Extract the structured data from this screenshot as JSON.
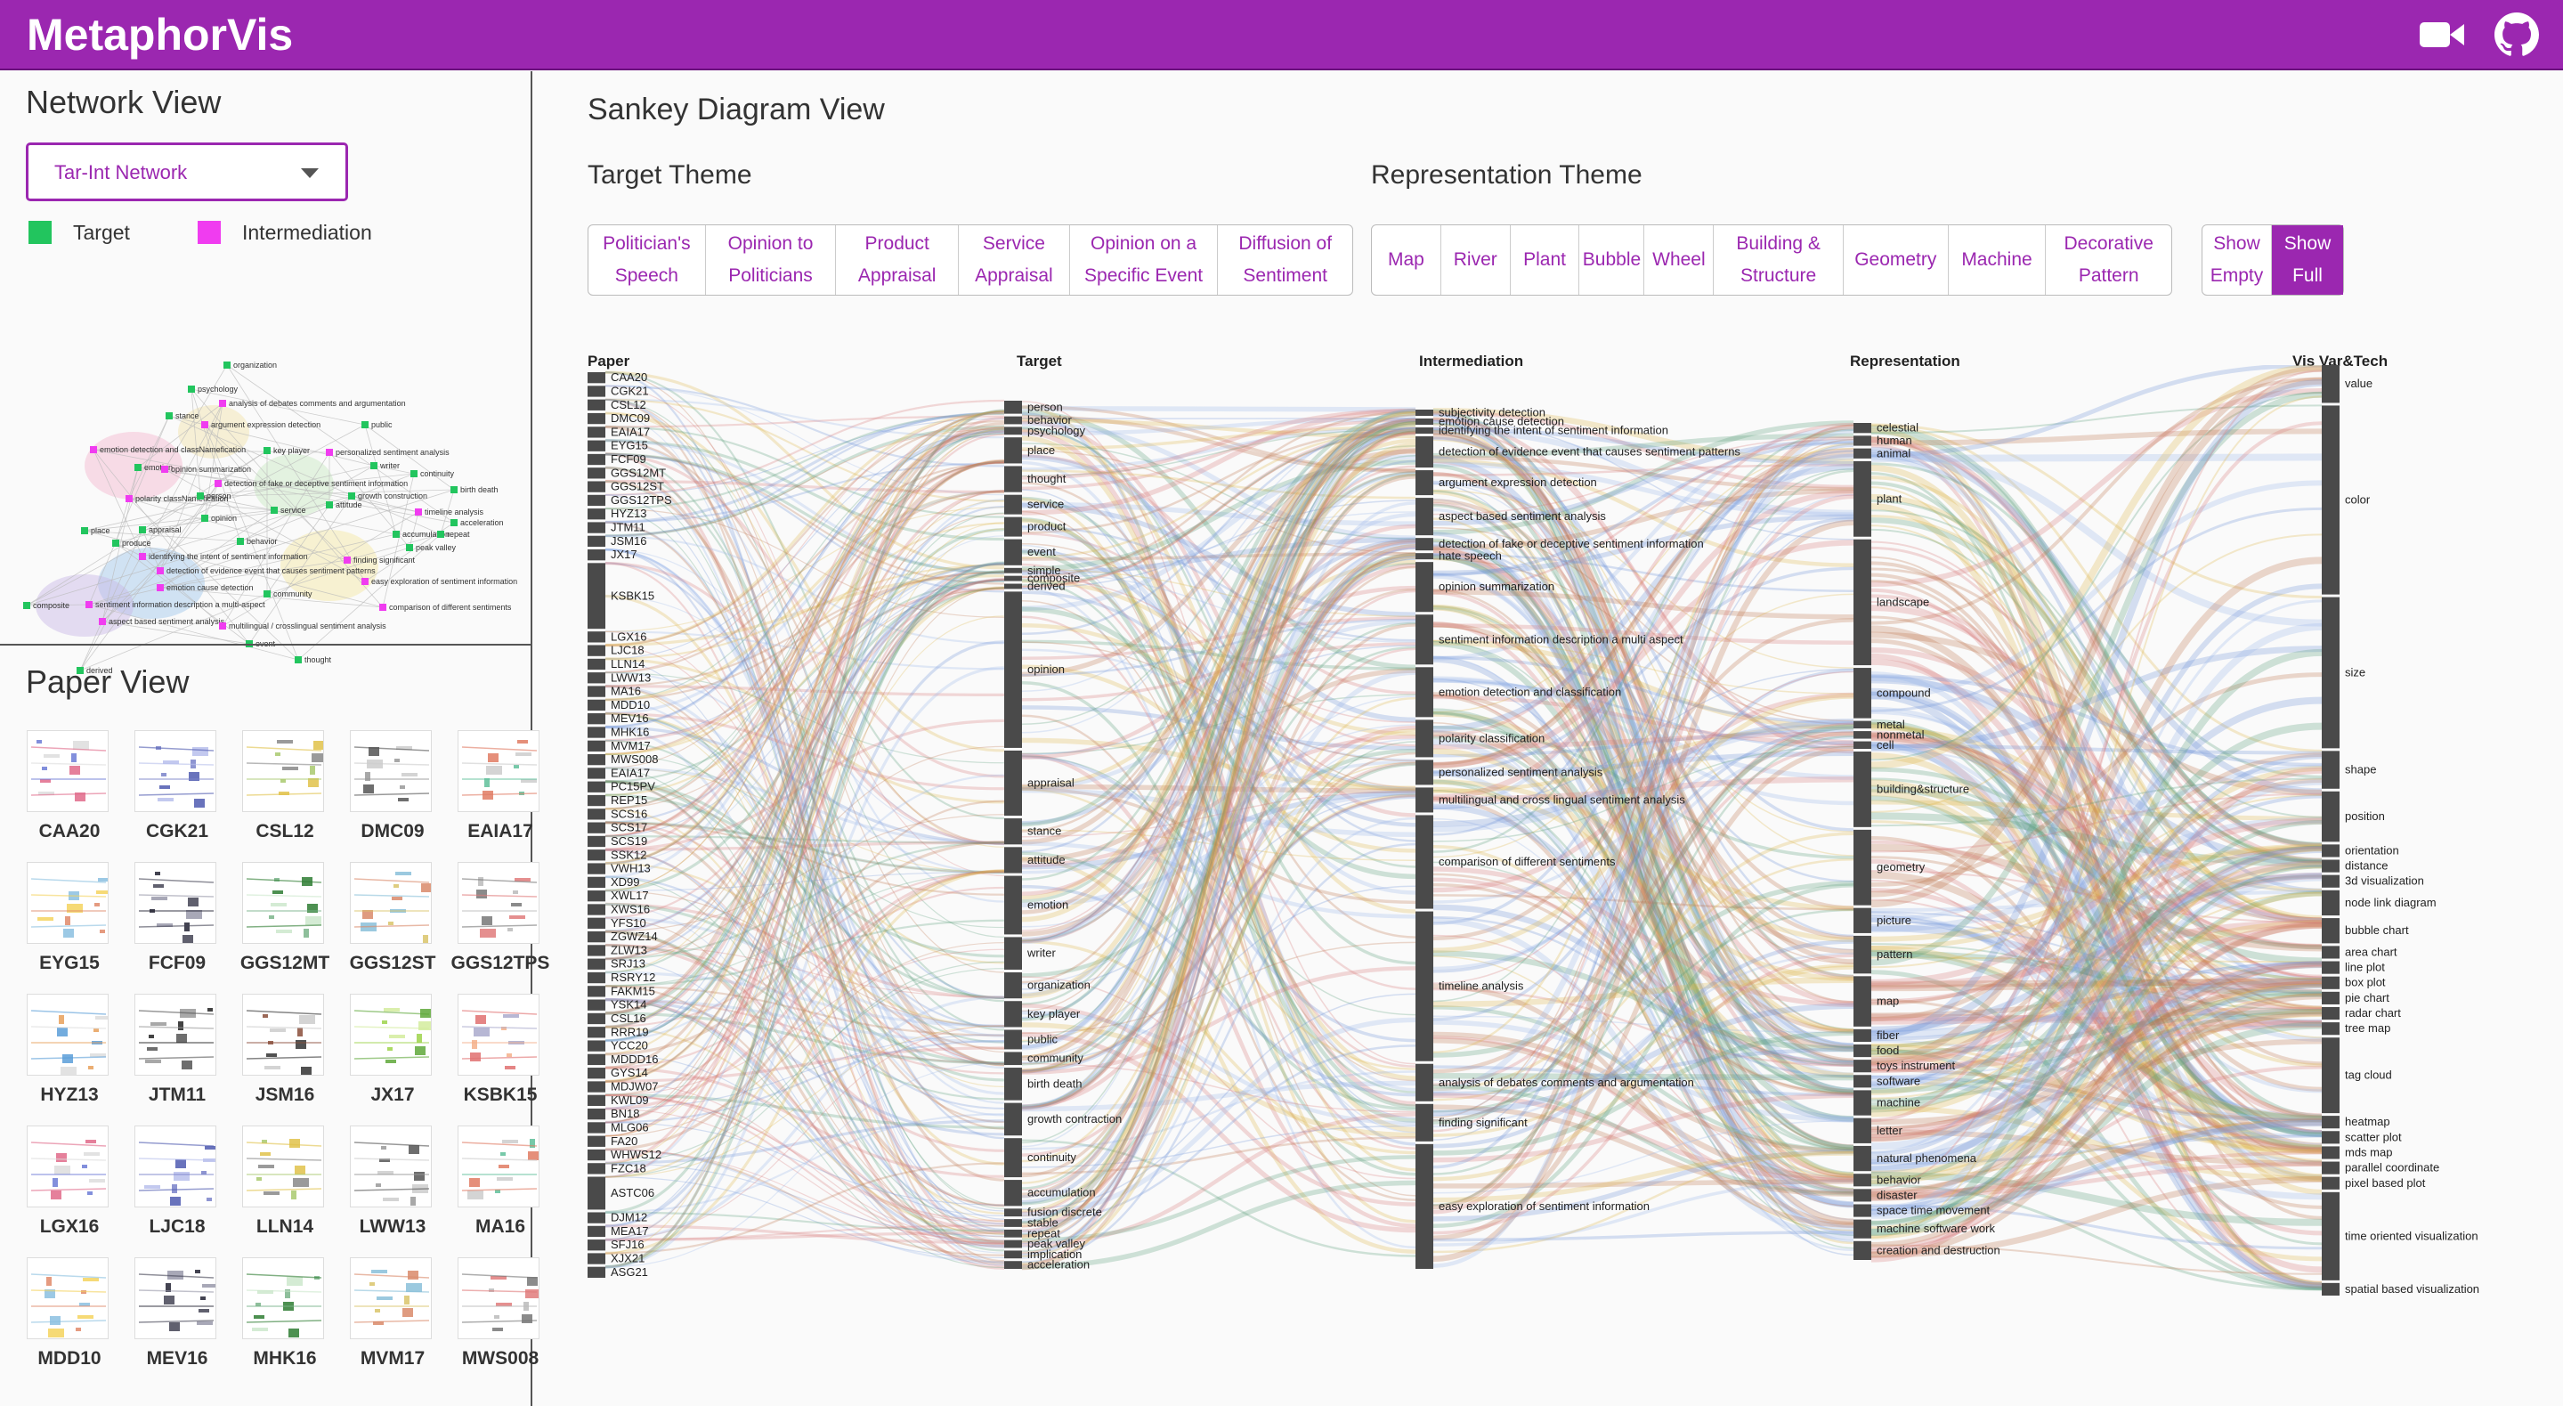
{
  "app": {
    "title": "MetaphorVis"
  },
  "toolbar": {
    "video_icon": "video-camera-icon",
    "github_icon": "github-icon"
  },
  "network_view": {
    "title": "Network View",
    "dropdown_value": "Tar-Int Network",
    "legend": [
      {
        "label": "Target",
        "color": "#22c55e"
      },
      {
        "label": "Intermediation",
        "color": "#f03cf0"
      }
    ],
    "nodes": [
      {
        "label": "organization",
        "type": "target"
      },
      {
        "label": "psychology",
        "type": "target"
      },
      {
        "label": "analysis of debates comments and argumentation",
        "type": "intermediation"
      },
      {
        "label": "stance",
        "type": "target"
      },
      {
        "label": "argument expression detection",
        "type": "intermediation"
      },
      {
        "label": "public",
        "type": "target"
      },
      {
        "label": "emotion detection and classNamefication",
        "type": "intermediation"
      },
      {
        "label": "key player",
        "type": "target"
      },
      {
        "label": "personalized sentiment analysis",
        "type": "intermediation"
      },
      {
        "label": "writer",
        "type": "target"
      },
      {
        "label": "emotion",
        "type": "target"
      },
      {
        "label": "opinion summarization",
        "type": "intermediation"
      },
      {
        "label": "continuity",
        "type": "target"
      },
      {
        "label": "detection of fake or deceptive sentiment information",
        "type": "intermediation"
      },
      {
        "label": "birth death",
        "type": "target"
      },
      {
        "label": "polarity classNamefication",
        "type": "intermediation"
      },
      {
        "label": "person",
        "type": "target"
      },
      {
        "label": "growth construction",
        "type": "target"
      },
      {
        "label": "attitude",
        "type": "target"
      },
      {
        "label": "timeline analysis",
        "type": "intermediation"
      },
      {
        "label": "service",
        "type": "target"
      },
      {
        "label": "opinion",
        "type": "target"
      },
      {
        "label": "acceleration",
        "type": "target"
      },
      {
        "label": "place",
        "type": "target"
      },
      {
        "label": "appraisal",
        "type": "target"
      },
      {
        "label": "accumulation",
        "type": "target"
      },
      {
        "label": "repeat",
        "type": "target"
      },
      {
        "label": "behavior",
        "type": "target"
      },
      {
        "label": "produce",
        "type": "target"
      },
      {
        "label": "peak valley",
        "type": "target"
      },
      {
        "label": "identifying the intent of sentiment information",
        "type": "intermediation"
      },
      {
        "label": "finding significant",
        "type": "intermediation"
      },
      {
        "label": "detection of evidence event that causes sentiment patterns",
        "type": "intermediation"
      },
      {
        "label": "easy exploration of sentiment information",
        "type": "intermediation"
      },
      {
        "label": "emotion cause detection",
        "type": "intermediation"
      },
      {
        "label": "community",
        "type": "target"
      },
      {
        "label": "composite",
        "type": "target"
      },
      {
        "label": "sentiment information description a multi-aspect",
        "type": "intermediation"
      },
      {
        "label": "comparison of different sentiments",
        "type": "intermediation"
      },
      {
        "label": "aspect based sentiment analysis",
        "type": "intermediation"
      },
      {
        "label": "multilingual / crosslingual sentiment analysis",
        "type": "intermediation"
      },
      {
        "label": "event",
        "type": "target"
      },
      {
        "label": "thought",
        "type": "target"
      },
      {
        "label": "derived",
        "type": "target"
      }
    ]
  },
  "paper_view": {
    "title": "Paper View",
    "papers": [
      "CAA20",
      "CGK21",
      "CSL12",
      "DMC09",
      "EAIA17",
      "EYG15",
      "FCF09",
      "GGS12MT",
      "GGS12ST",
      "GGS12TPS",
      "HYZ13",
      "JTM11",
      "JSM16",
      "JX17",
      "KSBK15",
      "LGX16",
      "LJC18",
      "LLN14",
      "LWW13",
      "MA16",
      "MDD10",
      "MEV16",
      "MHK16",
      "MVM17",
      "MWS008"
    ]
  },
  "sankey_view": {
    "title": "Sankey Diagram View",
    "target_theme_title": "Target Theme",
    "representation_theme_title": "Representation Theme",
    "target_buttons": [
      "Politician's\nSpeech",
      "Opinion to\nPoliticians",
      "Product\nAppraisal",
      "Service\nAppraisal",
      "Opinion on a\nSpecific Event",
      "Diffusion of\nSentiment"
    ],
    "representation_buttons": [
      "Map",
      "River",
      "Plant",
      "Bubble",
      "Wheel",
      "Building &\nStructure",
      "Geometry",
      "Machine",
      "Decorative\nPattern"
    ],
    "show_buttons": {
      "empty": "Show\nEmpty",
      "full": "Show\nFull",
      "active": "full"
    },
    "columns": {
      "paper": "Paper",
      "target": "Target",
      "intermediation": "Intermediation",
      "representation": "Representation",
      "vistech": "Vis Var&Tech"
    },
    "paper_nodes": [
      "CAA20",
      "CGK21",
      "CSL12",
      "DMC09",
      "EAIA17",
      "EYG15",
      "FCF09",
      "GGS12MT",
      "GGS12ST",
      "GGS12TPS",
      "HYZ13",
      "JTM11",
      "JSM16",
      "JX17",
      "KSBK15",
      "LGX16",
      "LJC18",
      "LLN14",
      "LWW13",
      "MA16",
      "MDD10",
      "MEV16",
      "MHK16",
      "MVM17",
      "MWS008",
      "EAIA17",
      "PC15PV",
      "REP15",
      "SCS16",
      "SCS17",
      "SCS19",
      "SSK12",
      "VWH13",
      "XD99",
      "XWL17",
      "XWS16",
      "YFS10",
      "ZGWZ14",
      "ZLW13",
      "SRJ13",
      "RSRY12",
      "FAKM15",
      "YSK14",
      "CSL16",
      "RRR19",
      "YCC20",
      "MDDD16",
      "GYS14",
      "MDJW07",
      "KWL09",
      "BN18",
      "MLG06",
      "FA20",
      "WHWS12",
      "FZC18",
      "ASTC06",
      "DJM12",
      "MEA17",
      "SFJ16",
      "XJX21",
      "ASG21"
    ],
    "target_nodes": [
      "person",
      "behavior",
      "psychology",
      "place",
      "thought",
      "service",
      "product",
      "event",
      "simple",
      "composite",
      "derived",
      "opinion",
      "appraisal",
      "stance",
      "attitude",
      "emotion",
      "writer",
      "organization",
      "key player",
      "public",
      "community",
      "birth death",
      "growth contraction",
      "continuity",
      "accumulation",
      "fusion discrete",
      "stable",
      "repeat",
      "peak valley",
      "implication",
      "acceleration"
    ],
    "intermediation_nodes": [
      "subjectivity detection",
      "emotion cause detection",
      "identifying the intent of sentiment information",
      "detection of evidence event that causes sentiment patterns",
      "argument expression detection",
      "aspect based sentiment analysis",
      "detection of fake or deceptive sentiment information",
      "hate speech",
      "opinion summarization",
      "sentiment information description a multi aspect",
      "emotion detection and classification",
      "polarity classification",
      "personalized sentiment analysis",
      "multilingual and cross lingual sentiment analysis",
      "comparison of different sentiments",
      "timeline analysis",
      "analysis of debates comments and argumentation",
      "finding significant",
      "easy exploration of sentiment information"
    ],
    "representation_nodes": [
      "celestial",
      "human",
      "animal",
      "plant",
      "landscape",
      "compound",
      "metal",
      "nonmetal",
      "cell",
      "building&structure",
      "geometry",
      "picture",
      "pattern",
      "map",
      "fiber",
      "food",
      "toys instrument",
      "software",
      "machine",
      "letter",
      "natural phenomena",
      "behavior",
      "disaster",
      "space time movement",
      "machine software work",
      "creation and destruction"
    ],
    "vistech_nodes": [
      "value",
      "color",
      "size",
      "shape",
      "position",
      "orientation",
      "distance",
      "3d visualization",
      "node link diagram",
      "bubble chart",
      "area chart",
      "line plot",
      "box plot",
      "pie chart",
      "radar chart",
      "tree map",
      "tag cloud",
      "heatmap",
      "scatter plot",
      "mds map",
      "parallel coordinate",
      "pixel based plot",
      "time oriented visualization",
      "spatial based visualization"
    ],
    "flow_colors": [
      "#5a9e7a",
      "#c0784e",
      "#6f95d8",
      "#e0b84a",
      "#d97a7a",
      "#9bb8e8"
    ]
  }
}
